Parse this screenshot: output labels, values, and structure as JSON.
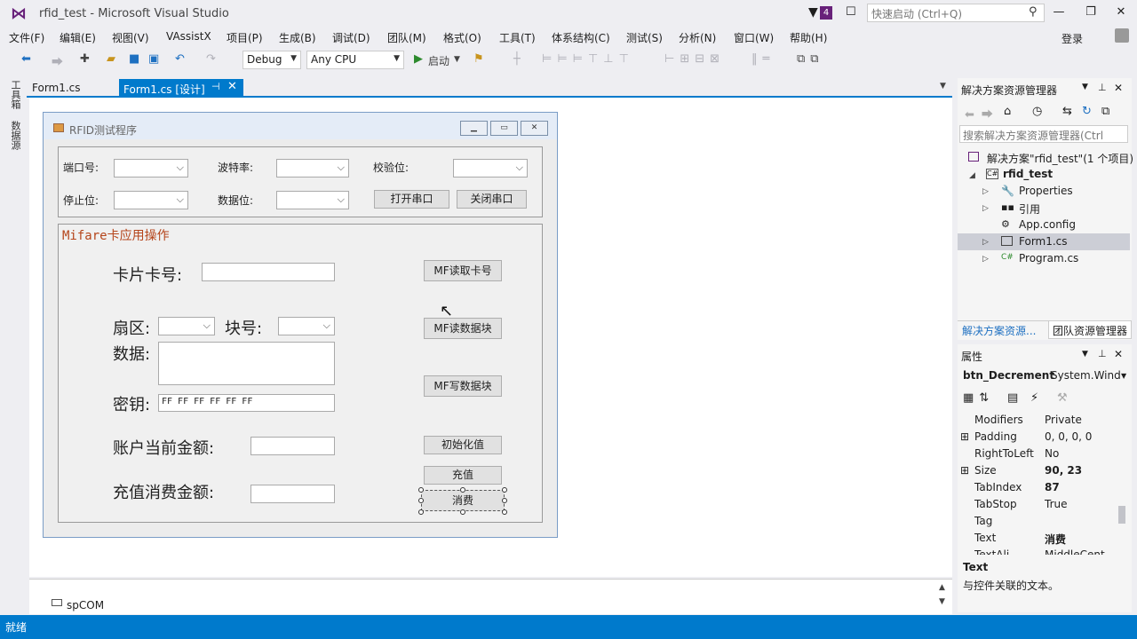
{
  "window": {
    "title": "rfid_test - Microsoft Visual Studio",
    "notification_count": "4",
    "quick_launch_placeholder": "快速启动 (Ctrl+Q)",
    "login": "登录"
  },
  "menu": [
    "文件(F)",
    "编辑(E)",
    "视图(V)",
    "VAssistX",
    "项目(P)",
    "生成(B)",
    "调试(D)",
    "团队(M)",
    "格式(O)",
    "工具(T)",
    "体系结构(C)",
    "测试(S)",
    "分析(N)",
    "窗口(W)",
    "帮助(H)"
  ],
  "toolbar": {
    "configuration": "Debug",
    "platform": "Any CPU",
    "start_label": "启动"
  },
  "left_dock": {
    "toolbox": "工具箱",
    "datasources": "数据源"
  },
  "doc_tabs": {
    "tab1": "Form1.cs",
    "tab2": "Form1.cs [设计]"
  },
  "form": {
    "title": "RFID测试程序",
    "serial": {
      "port_label": "端口号:",
      "baud_label": "波特率:",
      "parity_label": "校验位:",
      "stopbits_label": "停止位:",
      "databits_label": "数据位:",
      "open_button": "打开串口",
      "close_button": "关闭串口"
    },
    "mifare": {
      "caption": "Mifare卡应用操作",
      "card_no_label": "卡片卡号:",
      "sector_label": "扇区:",
      "block_label": "块号:",
      "data_label": "数据:",
      "key_label": "密钥:",
      "key_value": "FF FF FF FF FF FF",
      "balance_label": "账户当前金额:",
      "amount_label": "充值消费金额:",
      "read_card_button": "MF读取卡号",
      "read_block_button": "MF读数据块",
      "write_block_button": "MF写数据块",
      "init_button": "初始化值",
      "recharge_button": "充值",
      "consume_button": "消费"
    }
  },
  "component_tray": {
    "item": "spCOM"
  },
  "solution_explorer": {
    "title": "解决方案资源管理器",
    "search_placeholder": "搜索解决方案资源管理器(Ctrl",
    "solution": "解决方案\"rfid_test\"(1 个项目)",
    "project": "rfid_test",
    "items": [
      "Properties",
      "引用",
      "App.config",
      "Form1.cs",
      "Program.cs"
    ],
    "tab_se": "解决方案资源...",
    "tab_team": "团队资源管理器"
  },
  "properties": {
    "title": "属性",
    "object": "btn_Decrement",
    "object_type": "System.Wind",
    "rows": [
      {
        "name": "Modifiers",
        "value": "Private"
      },
      {
        "name": "Padding",
        "value": "0, 0, 0, 0"
      },
      {
        "name": "RightToLeft",
        "value": "No"
      },
      {
        "name": "Size",
        "value": "90, 23"
      },
      {
        "name": "TabIndex",
        "value": "87"
      },
      {
        "name": "TabStop",
        "value": "True"
      },
      {
        "name": "Tag",
        "value": ""
      },
      {
        "name": "Text",
        "value": "消费"
      },
      {
        "name": "TextAli",
        "value": "MiddleCent"
      }
    ],
    "desc_title": "Text",
    "desc_text": "与控件关联的文本。"
  },
  "status": {
    "text": "就绪"
  },
  "colors": {
    "accent": "#007acc",
    "vs_purple": "#68217a",
    "mifare_caption": "#b5451b"
  }
}
